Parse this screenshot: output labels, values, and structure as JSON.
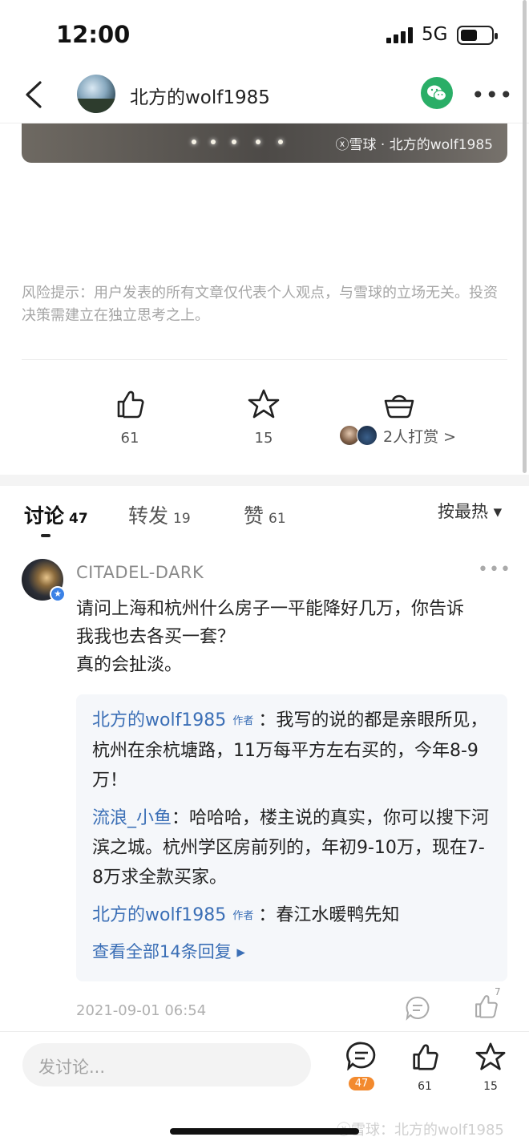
{
  "status_bar": {
    "time": "12:00",
    "network": "5G"
  },
  "nav": {
    "title": "北方的wolf1985"
  },
  "image": {
    "watermark": "ⓧ雪球 · 北方的wolf1985"
  },
  "risk_notice": "风险提示：用户发表的所有文章仅代表个人观点，与雪球的立场无关。投资决策需建立在独立思考之上。",
  "actions": {
    "like_count": "61",
    "favorite_count": "15",
    "reward_text": "2人打赏 >"
  },
  "tabs": [
    {
      "label": "讨论",
      "count": "47"
    },
    {
      "label": "转发",
      "count": "19"
    },
    {
      "label": "赞",
      "count": "61"
    }
  ],
  "sort_label": "按最热 ▾",
  "comment": {
    "user": "CITADEL-DARK",
    "lines": [
      "请问上海和杭州什么房子一平能降好几万，你告诉",
      "我我也去各买一套？",
      "真的会扯淡。"
    ],
    "time": "2021-09-01 06:54",
    "like_count": "7",
    "replies": [
      {
        "user": "北方的wolf1985",
        "tag": "作者",
        "text": "：我写的说的都是亲眼所见，杭州在余杭塘路，11万每平方左右买的，今年8-9万！"
      },
      {
        "user": "流浪_小鱼",
        "tag": "",
        "text": "：哈哈哈，楼主说的真实，你可以搜下河滨之城。杭州学区房前列的，年初9-10万，现在7-8万求全款买家。"
      },
      {
        "user": "北方的wolf1985",
        "tag": "作者",
        "text": "：春江水暖鸭先知"
      }
    ],
    "view_all": "查看全部14条回复 ▸"
  },
  "bottom_bar": {
    "input_placeholder": "发讨论...",
    "comment_count": "47",
    "like_count": "61",
    "favorite_count": "15",
    "watermark": "ⓧ雪球：北方的wolf1985"
  },
  "colors": {
    "link": "#3b6fb6",
    "wechat": "#2aae67",
    "badge_orange": "#f38a2e"
  }
}
